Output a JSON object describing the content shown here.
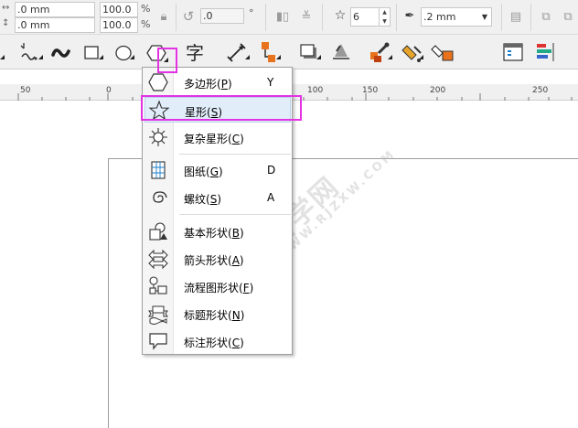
{
  "propbar": {
    "width_value": ".0 mm",
    "height_value": ".0 mm",
    "scale_x": "100.0",
    "scale_y": "100.0",
    "percent": "%",
    "rotation": ".0",
    "degree": "°",
    "star_points": "6",
    "outline_width": ".2 mm"
  },
  "ruler": {
    "labels": [
      "50",
      "0",
      "50",
      "100",
      "150",
      "200",
      "250"
    ]
  },
  "menu": {
    "items": [
      {
        "label": "多边形",
        "key": "P",
        "shortcut": "Y"
      },
      {
        "label": "星形",
        "key": "S",
        "shortcut": ""
      },
      {
        "label": "复杂星形",
        "key": "C",
        "shortcut": ""
      },
      {
        "label": "图纸",
        "key": "G",
        "shortcut": "D"
      },
      {
        "label": "螺纹",
        "key": "S",
        "shortcut": "A"
      },
      {
        "label": "基本形状",
        "key": "B",
        "shortcut": ""
      },
      {
        "label": "箭头形状",
        "key": "A",
        "shortcut": ""
      },
      {
        "label": "流程图形状",
        "key": "F",
        "shortcut": ""
      },
      {
        "label": "标题形状",
        "key": "N",
        "shortcut": ""
      },
      {
        "label": "标注形状",
        "key": "C",
        "shortcut": ""
      }
    ]
  },
  "watermark": {
    "text": "软件自学网",
    "url": "WWW.RJZXW.COM"
  },
  "colors": {
    "highlight_box": "#e333e3",
    "menu_hover": "#e1edf9"
  }
}
